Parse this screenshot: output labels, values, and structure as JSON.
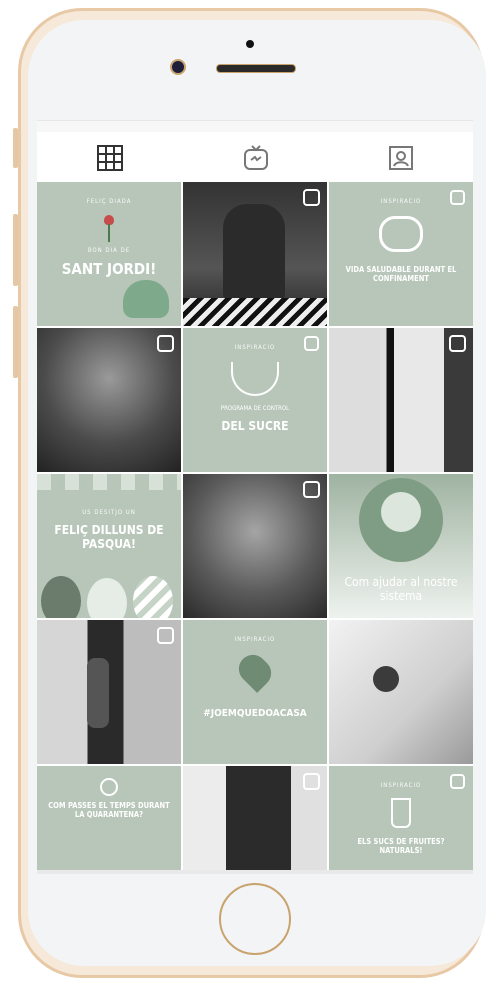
{
  "profile_tabs": [
    {
      "name": "grid",
      "icon": "grid-icon"
    },
    {
      "name": "igtv",
      "icon": "igtv-icon"
    },
    {
      "name": "tagged",
      "icon": "tagged-icon"
    }
  ],
  "posts": [
    {
      "kind": "green",
      "title": "SANT JORDI!"
    },
    {
      "kind": "photo"
    },
    {
      "kind": "green",
      "title": "VIDA SALUDABLE DURANT EL CONFINAMENT"
    },
    {
      "kind": "photo"
    },
    {
      "kind": "green",
      "title": "DEL SUCRE",
      "subtitle": "PROGRAMA DE CONTROL"
    },
    {
      "kind": "photo"
    },
    {
      "kind": "green",
      "title": "FELIÇ DILLUNS DE PASQUA!"
    },
    {
      "kind": "photo"
    },
    {
      "kind": "green",
      "title": "Com ajudar al nostre sistema"
    },
    {
      "kind": "photo"
    },
    {
      "kind": "green",
      "title": "#JOEMQUEDOACASA"
    },
    {
      "kind": "photo"
    },
    {
      "kind": "green",
      "title": "COM PASSES EL TEMPS DURANT LA QUARANTENA?"
    },
    {
      "kind": "photo"
    },
    {
      "kind": "green",
      "title": "ELS SUCS DE FRUITES? NATURALS!"
    }
  ],
  "colors": {
    "sage": "#b7c6b9",
    "frame": "#e8c9a6"
  }
}
